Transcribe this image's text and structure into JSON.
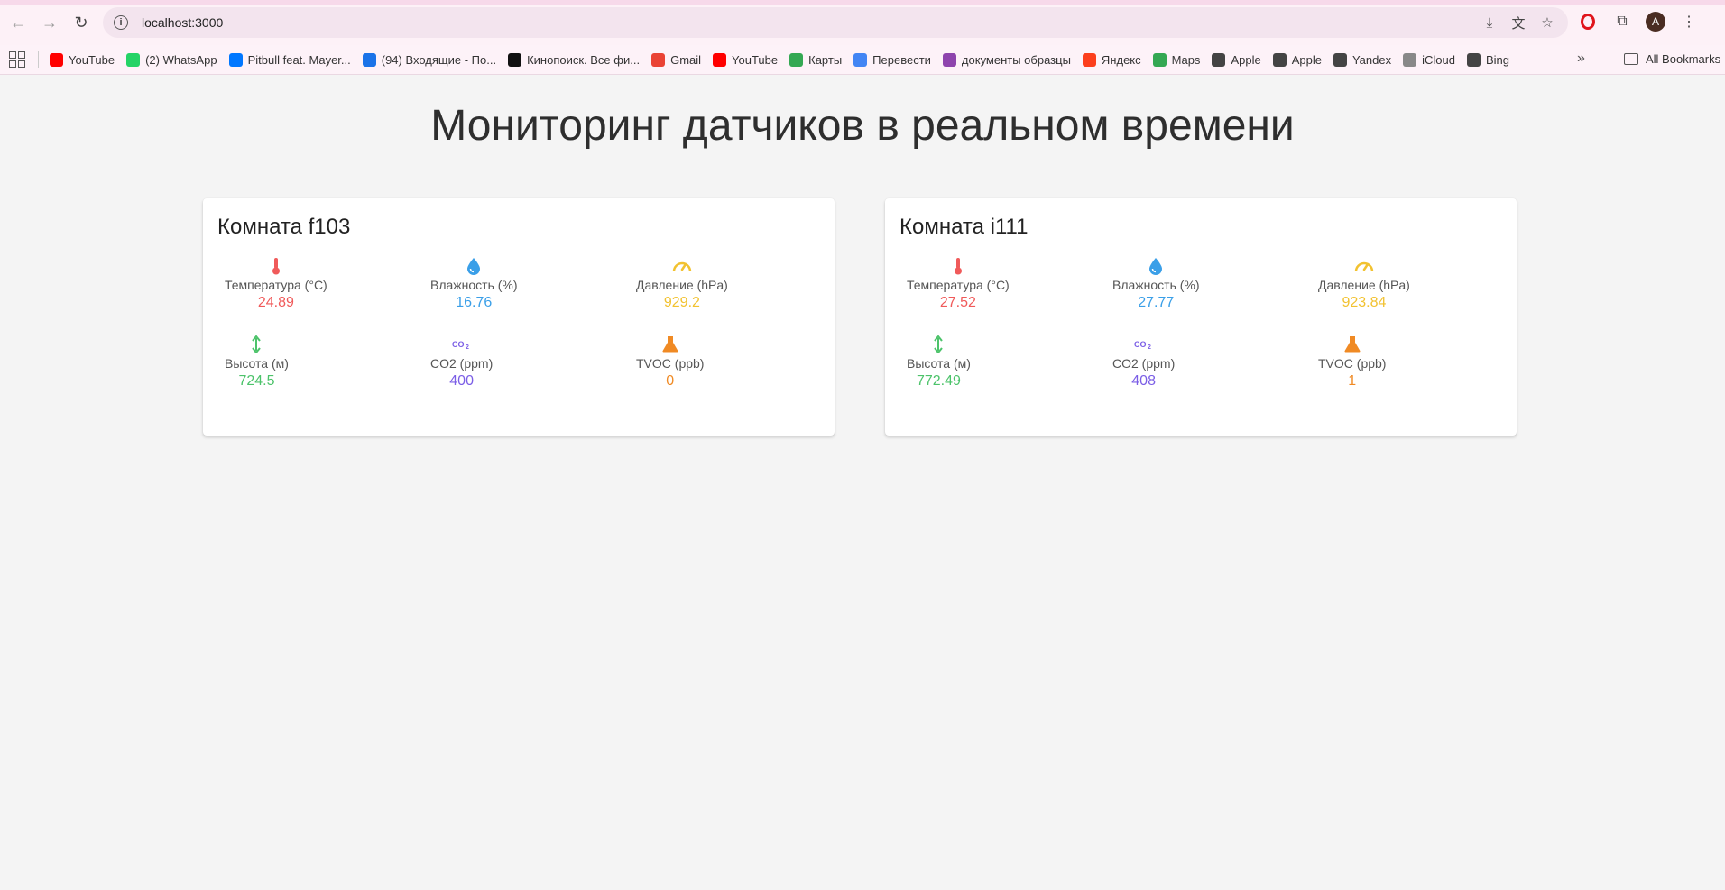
{
  "browser": {
    "url": "localhost:3000",
    "bookmarks": [
      {
        "label": "YouTube",
        "color": "#ff0000"
      },
      {
        "label": "(2) WhatsApp",
        "color": "#25d366"
      },
      {
        "label": "Pitbull feat. Mayer...",
        "color": "#0077ff"
      },
      {
        "label": "(94) Входящие - По...",
        "color": "#1a73e8"
      },
      {
        "label": "Кинопоиск. Все фи...",
        "color": "#111111"
      },
      {
        "label": "Gmail",
        "color": "#ea4335"
      },
      {
        "label": "YouTube",
        "color": "#ff0000"
      },
      {
        "label": "Карты",
        "color": "#34a853"
      },
      {
        "label": "Перевести",
        "color": "#4285f4"
      },
      {
        "label": "документы образцы",
        "color": "#8e44ad"
      },
      {
        "label": "Яндекс",
        "color": "#fc3f1d"
      },
      {
        "label": "Maps",
        "color": "#34a853"
      },
      {
        "label": "Apple",
        "color": "#444444"
      },
      {
        "label": "Apple",
        "color": "#444444"
      },
      {
        "label": "Yandex",
        "color": "#444444"
      },
      {
        "label": "iCloud",
        "color": "#888888"
      },
      {
        "label": "Bing",
        "color": "#444444"
      }
    ],
    "all_bookmarks": "All Bookmarks",
    "avatar_letter": "A"
  },
  "page": {
    "title": "Мониторинг датчиков в реальном времени"
  },
  "rooms": [
    {
      "title": "Комната f103",
      "temperature": {
        "label": "Температура (°C)",
        "value": "24.89"
      },
      "humidity": {
        "label": "Влажность (%)",
        "value": "16.76"
      },
      "pressure": {
        "label": "Давление (hPa)",
        "value": "929.2"
      },
      "altitude": {
        "label": "Высота (м)",
        "value": "724.5"
      },
      "co2": {
        "label": "CO2 (ppm)",
        "value": "400"
      },
      "tvoc": {
        "label": "TVOC (ppb)",
        "value": "0"
      }
    },
    {
      "title": "Комната i111",
      "temperature": {
        "label": "Температура (°C)",
        "value": "27.52"
      },
      "humidity": {
        "label": "Влажность (%)",
        "value": "27.77"
      },
      "pressure": {
        "label": "Давление (hPa)",
        "value": "923.84"
      },
      "altitude": {
        "label": "Высота (м)",
        "value": "772.49"
      },
      "co2": {
        "label": "CO2 (ppm)",
        "value": "408"
      },
      "tvoc": {
        "label": "TVOC (ppb)",
        "value": "1"
      }
    }
  ],
  "icons": {
    "temperature": "thermometer-icon",
    "humidity": "water-drop-icon",
    "pressure": "gauge-icon",
    "altitude": "vertical-arrows-icon",
    "co2": "co2-icon",
    "tvoc": "flask-icon"
  },
  "colors": {
    "temperature": "#f05a5a",
    "humidity": "#3a9fe8",
    "pressure": "#f2c230",
    "altitude": "#4cc36a",
    "co2": "#7b5ee6",
    "tvoc": "#f08a24"
  }
}
